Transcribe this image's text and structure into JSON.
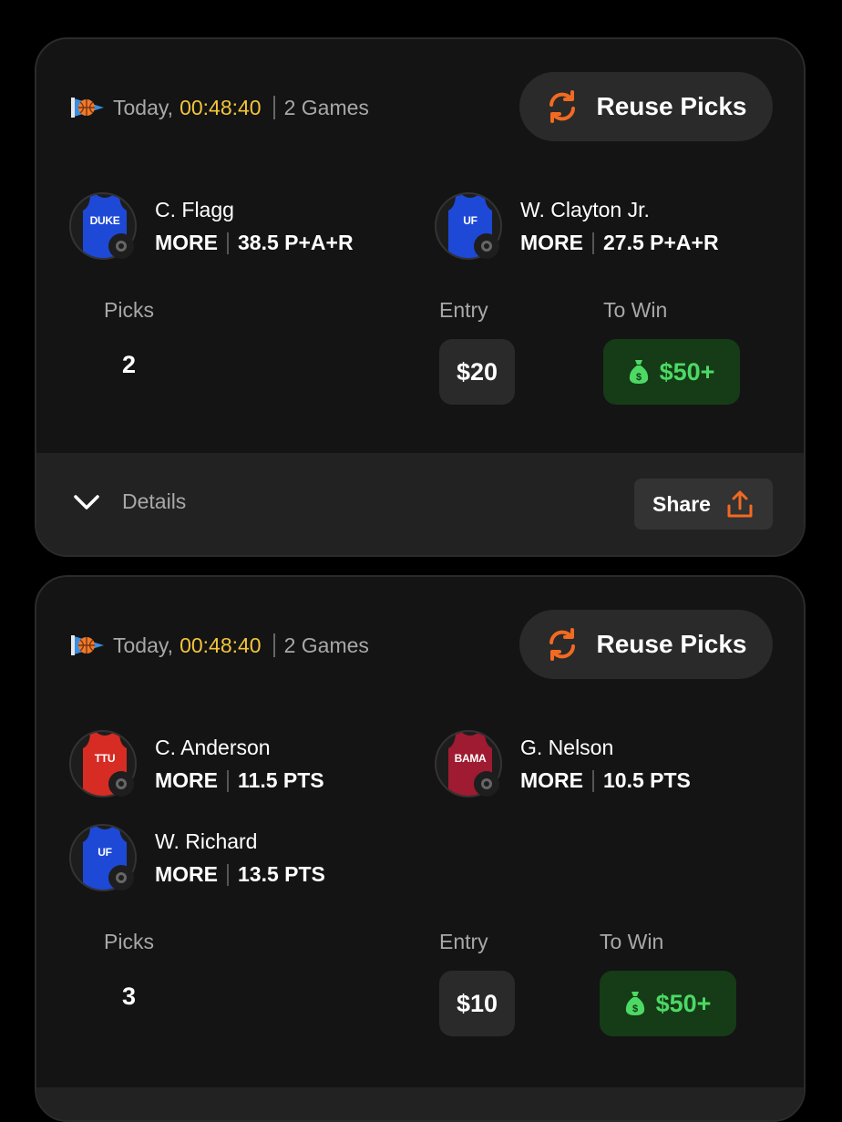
{
  "entries": [
    {
      "date_label": "Today,",
      "timer": "00:48:40",
      "games": "2 Games",
      "reuse_label": "Reuse Picks",
      "picks": [
        {
          "name": "C. Flagg",
          "direction": "MORE",
          "line": "38.5 P+A+R",
          "jersey_text": "DUKE",
          "jersey_color": "#1e49d6"
        },
        {
          "name": "W. Clayton Jr.",
          "direction": "MORE",
          "line": "27.5 P+A+R",
          "jersey_text": "UF",
          "jersey_color": "#1e49d6"
        }
      ],
      "picks_label": "Picks",
      "picks_count": "2",
      "entry_label": "Entry",
      "entry_value": "$20",
      "to_win_label": "To Win",
      "to_win_value": "$50+",
      "details_label": "Details",
      "share_label": "Share"
    },
    {
      "date_label": "Today,",
      "timer": "00:48:40",
      "games": "2 Games",
      "reuse_label": "Reuse Picks",
      "picks": [
        {
          "name": "C. Anderson",
          "direction": "MORE",
          "line": "11.5 PTS",
          "jersey_text": "TTU",
          "jersey_color": "#d62c24"
        },
        {
          "name": "G. Nelson",
          "direction": "MORE",
          "line": "10.5 PTS",
          "jersey_text": "BAMA",
          "jersey_color": "#9e1b32"
        },
        {
          "name": "W. Richard",
          "direction": "MORE",
          "line": "13.5 PTS",
          "jersey_text": "UF",
          "jersey_color": "#1e49d6"
        }
      ],
      "picks_label": "Picks",
      "picks_count": "3",
      "entry_label": "Entry",
      "entry_value": "$10",
      "to_win_label": "To Win",
      "to_win_value": "$50+"
    }
  ],
  "colors": {
    "timer": "#f3c53a",
    "accent_orange": "#f26a21",
    "win_green": "#4cd964",
    "win_bg": "#153b17",
    "card_bg": "#141414"
  },
  "icons": {
    "header": "basketball-pennant-icon",
    "reuse": "refresh-icon",
    "details": "chevron-down-icon",
    "share": "share-upload-icon",
    "to_win": "money-bag-icon",
    "badge": "pick-status-icon"
  }
}
